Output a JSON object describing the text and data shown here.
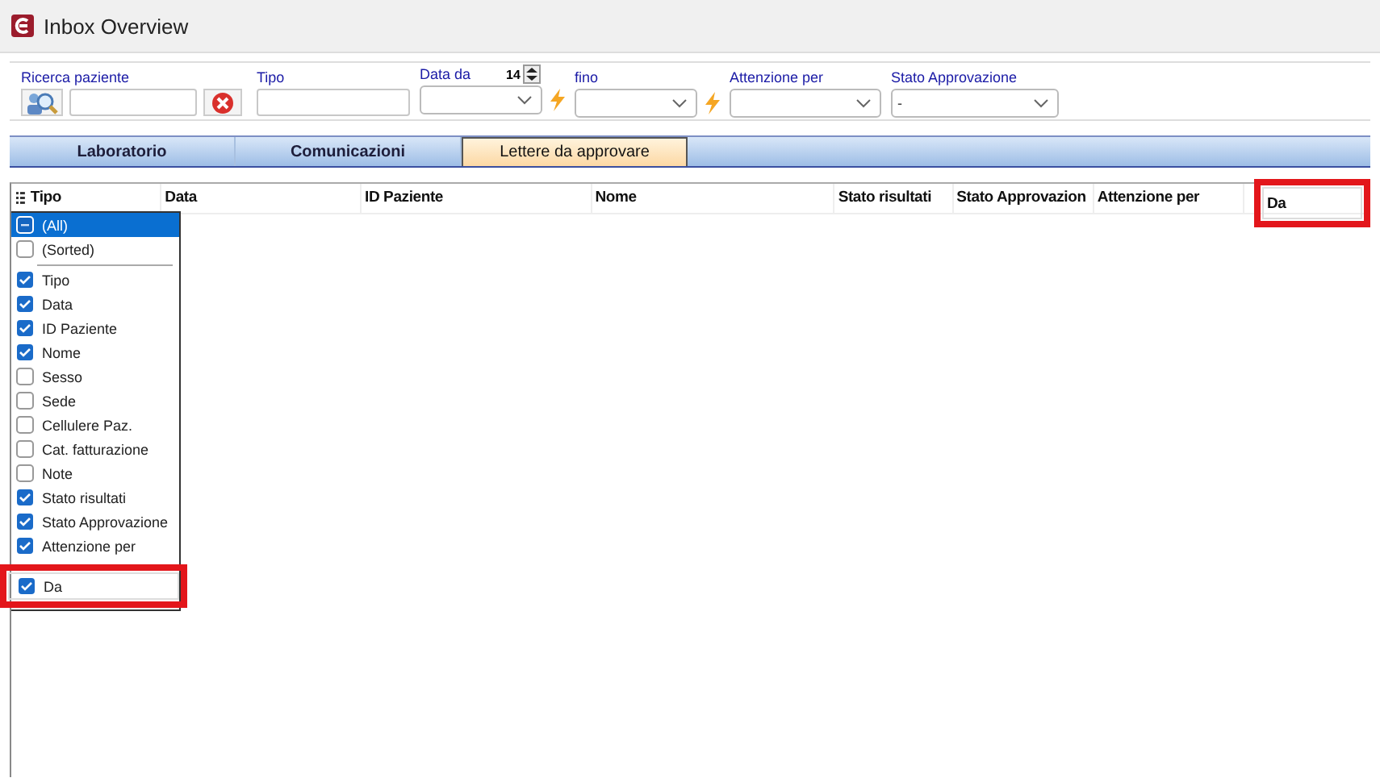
{
  "window": {
    "title": "Inbox Overview"
  },
  "filters": {
    "patient_search": {
      "label": "Ricerca paziente"
    },
    "tipo": {
      "label": "Tipo"
    },
    "data_da": {
      "label": "Data da",
      "spinner_value": "14"
    },
    "fino": {
      "label": "fino"
    },
    "attenzione_per": {
      "label": "Attenzione per"
    },
    "stato_approvazione": {
      "label": "Stato Approvazione",
      "value": "-"
    }
  },
  "tabs": [
    {
      "label": "Laboratorio",
      "selected": false
    },
    {
      "label": "Comunicazioni",
      "selected": false
    },
    {
      "label": "Lettere da approvare",
      "selected": true
    }
  ],
  "table": {
    "columns": [
      {
        "label": "Tipo",
        "highlighted": false
      },
      {
        "label": "Data",
        "highlighted": false
      },
      {
        "label": "ID Paziente",
        "highlighted": false
      },
      {
        "label": "Nome",
        "highlighted": false
      },
      {
        "label": "Stato risultati",
        "highlighted": false
      },
      {
        "label": "Stato Approvazion",
        "highlighted": false
      },
      {
        "label": "Attenzione per",
        "highlighted": false
      },
      {
        "label": "Da",
        "highlighted": true
      }
    ]
  },
  "column_chooser": {
    "items": [
      {
        "label": "(All)",
        "kind": "special",
        "checked": false,
        "selected": true,
        "highlighted": false
      },
      {
        "label": "(Sorted)",
        "kind": "special",
        "checked": false,
        "selected": false,
        "highlighted": false
      },
      {
        "label": "Tipo",
        "kind": "column",
        "checked": true,
        "selected": false,
        "highlighted": false
      },
      {
        "label": "Data",
        "kind": "column",
        "checked": true,
        "selected": false,
        "highlighted": false
      },
      {
        "label": "ID Paziente",
        "kind": "column",
        "checked": true,
        "selected": false,
        "highlighted": false
      },
      {
        "label": "Nome",
        "kind": "column",
        "checked": true,
        "selected": false,
        "highlighted": false
      },
      {
        "label": "Sesso",
        "kind": "column",
        "checked": false,
        "selected": false,
        "highlighted": false
      },
      {
        "label": "Sede",
        "kind": "column",
        "checked": false,
        "selected": false,
        "highlighted": false
      },
      {
        "label": "Cellulere Paz.",
        "kind": "column",
        "checked": false,
        "selected": false,
        "highlighted": false
      },
      {
        "label": "Cat. fatturazione",
        "kind": "column",
        "checked": false,
        "selected": false,
        "highlighted": false
      },
      {
        "label": "Note",
        "kind": "column",
        "checked": false,
        "selected": false,
        "highlighted": false
      },
      {
        "label": "Stato risultati",
        "kind": "column",
        "checked": true,
        "selected": false,
        "highlighted": false
      },
      {
        "label": "Stato Approvazione",
        "kind": "column",
        "checked": true,
        "selected": false,
        "highlighted": false
      },
      {
        "label": "Attenzione per",
        "kind": "column",
        "checked": true,
        "selected": false,
        "highlighted": false
      },
      {
        "label": "Da",
        "kind": "column",
        "checked": true,
        "selected": false,
        "highlighted": true
      }
    ]
  }
}
